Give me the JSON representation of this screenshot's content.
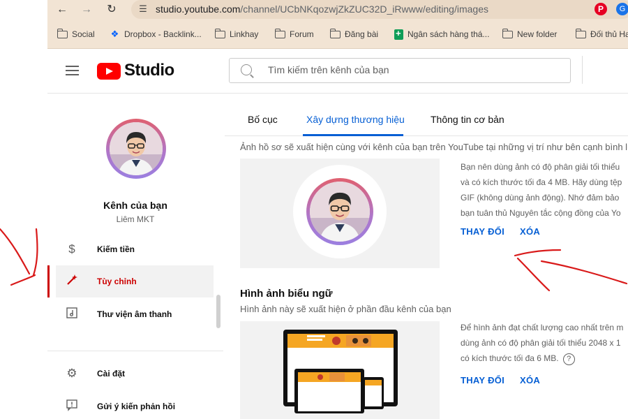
{
  "browser": {
    "url_host": "studio.youtube.com",
    "url_path": "/channel/UCbNKqozwjZkZUC32D_iRwww/editing/images",
    "bookmarks": [
      {
        "label": "Social",
        "icon": "folder-icon"
      },
      {
        "label": "Dropbox - Backlink...",
        "icon": "dropbox-icon"
      },
      {
        "label": "Linkhay",
        "icon": "folder-icon"
      },
      {
        "label": "Forum",
        "icon": "folder-icon"
      },
      {
        "label": "Đăng bài",
        "icon": "folder-icon"
      },
      {
        "label": "Ngân sách hàng thá...",
        "icon": "sheets-icon"
      },
      {
        "label": "New folder",
        "icon": "folder-icon"
      },
      {
        "label": "Đối thủ Ha",
        "icon": "folder-icon"
      }
    ]
  },
  "header": {
    "logo_text": "Studio",
    "search_placeholder": "Tìm kiếm trên kênh của bạn"
  },
  "sidebar": {
    "channel_title": "Kênh của bạn",
    "channel_name": "Liêm MKT",
    "items": [
      {
        "label": "Kiếm tiền",
        "icon": "dollar-icon"
      },
      {
        "label": "Tùy chỉnh",
        "icon": "magic-wand-icon",
        "active": true
      },
      {
        "label": "Thư viện âm thanh",
        "icon": "audio-library-icon"
      },
      {
        "label": "Cài đặt",
        "icon": "gear-icon"
      },
      {
        "label": "Gửi ý kiến phản hồi",
        "icon": "feedback-icon"
      }
    ]
  },
  "main": {
    "tabs": [
      {
        "label": "Bố cục"
      },
      {
        "label": "Xây dựng thương hiệu",
        "active": true
      },
      {
        "label": "Thông tin cơ bản"
      }
    ],
    "profile_photo": {
      "description": "Ảnh hồ sơ sẽ xuất hiện cùng với kênh của bạn trên YouTube tại những vị trí như bên cạnh bình luận",
      "info_lines": [
        "Bạn nên dùng ảnh có độ phân giải tối thiểu",
        "và có kích thước tối đa 4 MB. Hãy dùng tệp",
        "GIF (không dùng ảnh động). Nhớ đảm bảo",
        "bạn tuân thủ Nguyên tắc cộng đồng của Yo"
      ],
      "change_label": "THAY ĐỔI",
      "remove_label": "XÓA"
    },
    "banner": {
      "title": "Hình ảnh biểu ngữ",
      "description": "Hình ảnh này sẽ xuất hiện ở phần đầu kênh của bạn",
      "info_lines": [
        "Để hình ảnh đạt chất lượng cao nhất trên m",
        "dùng ảnh có độ phân giải tối thiểu 2048 x 1",
        "có kích thước tối đa 6 MB."
      ],
      "change_label": "THAY ĐỔI",
      "remove_label": "XÓA"
    }
  },
  "colors": {
    "accent_blue": "#065fd4",
    "active_red": "#cc0000",
    "annotation_red": "#d91a1a"
  }
}
